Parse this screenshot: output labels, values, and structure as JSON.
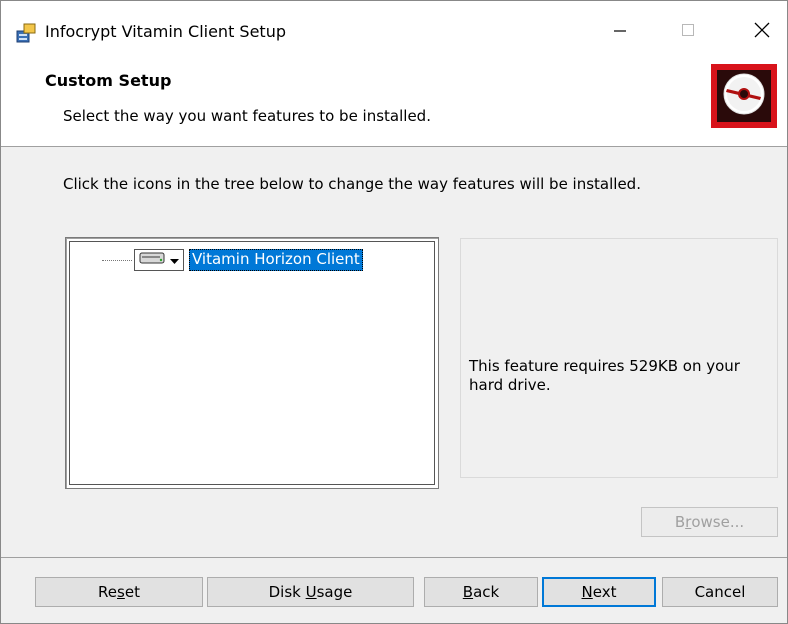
{
  "window": {
    "title": "Infocrypt Vitamin Client Setup"
  },
  "banner": {
    "title": "Custom Setup",
    "subtitle": "Select the way you want features to be installed.",
    "logo_icon": "disc-icon",
    "logo_color": "#d8131b"
  },
  "instruction": "Click the icons in the tree below to change the way features will be installed.",
  "tree": {
    "items": [
      {
        "label": "Vitamin Horizon Client",
        "icon": "hard-drive-icon",
        "selected": true
      }
    ]
  },
  "description": {
    "text": "This feature requires 529KB on your hard drive."
  },
  "buttons": {
    "browse": {
      "pre": "B",
      "accel": "r",
      "post": "owse..."
    },
    "reset": {
      "pre": "Re",
      "accel": "s",
      "post": "et"
    },
    "disk_usage": {
      "pre": "Disk ",
      "accel": "U",
      "post": "sage"
    },
    "back": {
      "pre": "",
      "accel": "B",
      "post": "ack"
    },
    "next": {
      "pre": "",
      "accel": "N",
      "post": "ext"
    },
    "cancel": {
      "label": "Cancel"
    }
  },
  "colors": {
    "selection": "#0078d7",
    "default_button_border": "#0078d7"
  }
}
